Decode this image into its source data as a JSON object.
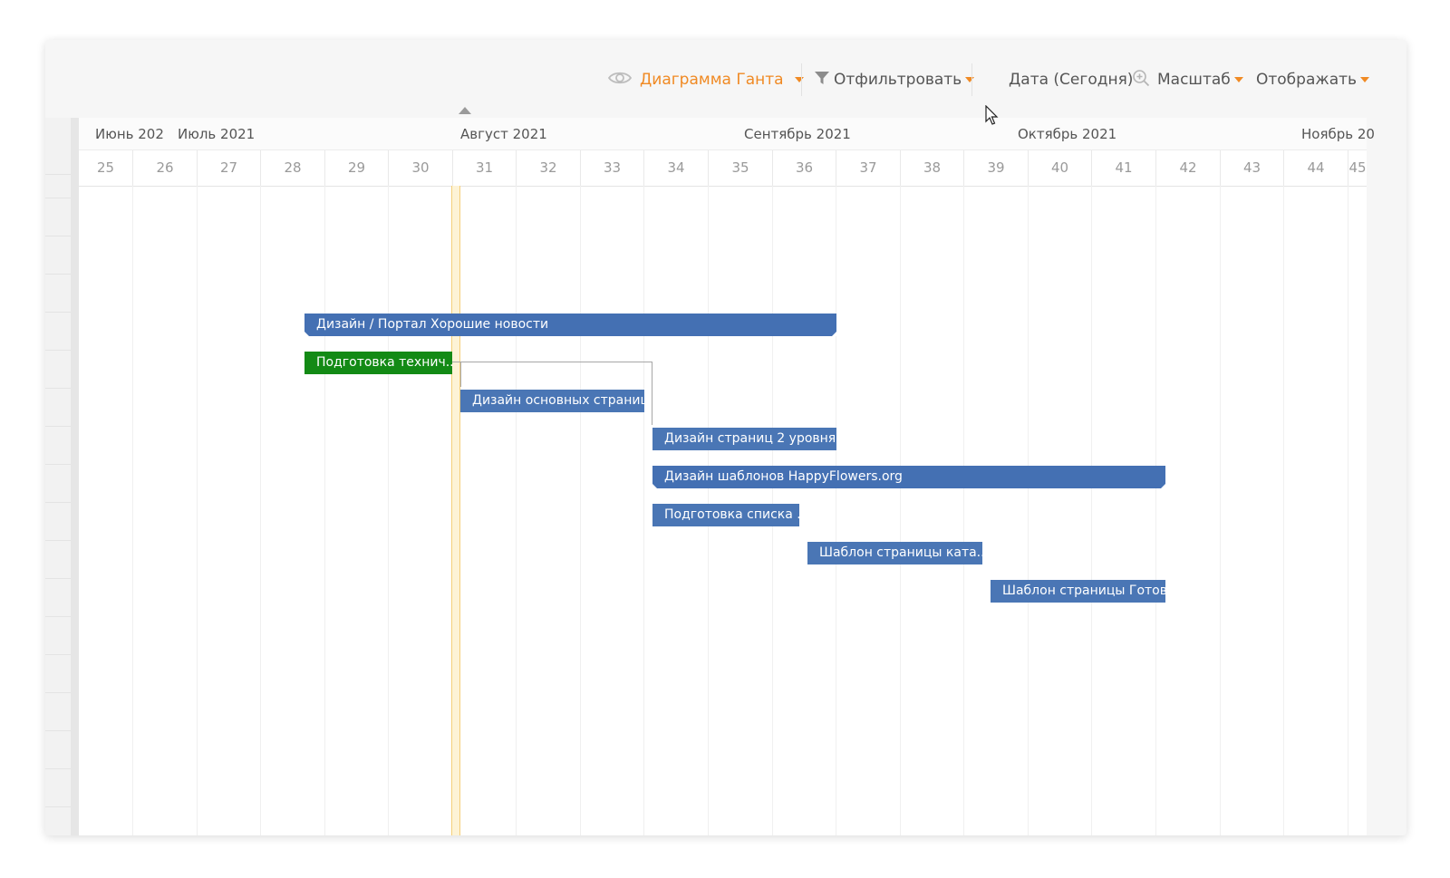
{
  "toolbar": {
    "view": {
      "label": "Диаграмма Ганта",
      "icon": "eye-icon"
    },
    "filter": {
      "label": "Отфильтровать",
      "icon": "filter-icon"
    },
    "date": {
      "label": "Дата (Сегодня)"
    },
    "zoom": {
      "label": "Масштаб",
      "icon": "zoom-in-icon"
    },
    "display": {
      "label": "Отображать"
    }
  },
  "timeline": {
    "months": [
      "Июнь 202",
      "Июль 2021",
      "Август 2021",
      "Сентябрь 2021",
      "Октябрь 2021",
      "Ноябрь 20"
    ],
    "weeks": [
      "25",
      "26",
      "27",
      "28",
      "29",
      "30",
      "31",
      "32",
      "33",
      "34",
      "35",
      "36",
      "37",
      "38",
      "39",
      "40",
      "41",
      "42",
      "43",
      "44",
      "45"
    ]
  },
  "tasks": [
    {
      "label": "Дизайн / Портал Хорошие новости",
      "type": "summary"
    },
    {
      "label": "Подготовка технич...",
      "type": "task",
      "status": "done"
    },
    {
      "label": "Дизайн основных страниц",
      "type": "task"
    },
    {
      "label": "Дизайн страниц 2 уровня",
      "type": "task"
    },
    {
      "label": "Дизайн шаблонов HappyFlowers.org",
      "type": "summary"
    },
    {
      "label": "Подготовка списка ...",
      "type": "task"
    },
    {
      "label": "Шаблон страницы ката...",
      "type": "task"
    },
    {
      "label": "Шаблон страницы Готов...",
      "type": "task"
    }
  ],
  "colors": {
    "accent": "#f08a24",
    "task_bar": "#4a76b5",
    "completed_bar": "#138a15",
    "today_marker": "#f5cf7a"
  }
}
